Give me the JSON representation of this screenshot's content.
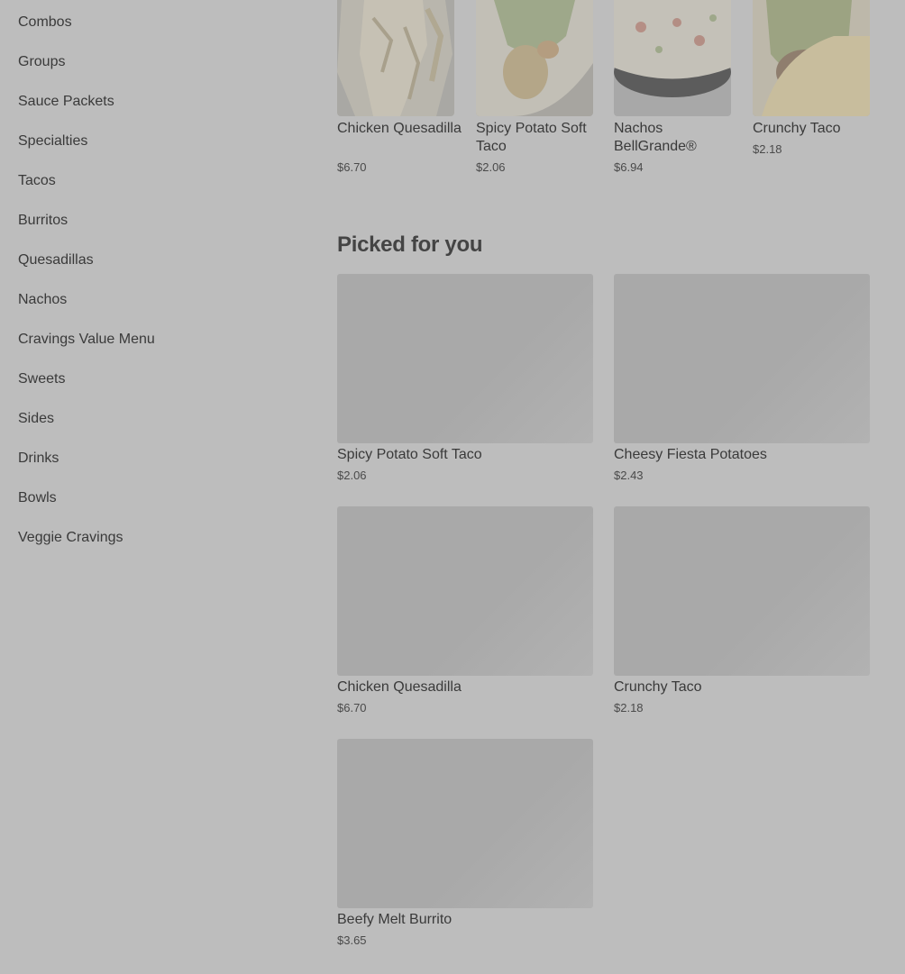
{
  "sidebar": {
    "items": [
      {
        "label": "Combos"
      },
      {
        "label": "Groups"
      },
      {
        "label": "Sauce Packets"
      },
      {
        "label": "Specialties"
      },
      {
        "label": "Tacos"
      },
      {
        "label": "Burritos"
      },
      {
        "label": "Quesadillas"
      },
      {
        "label": "Nachos"
      },
      {
        "label": "Cravings Value Menu"
      },
      {
        "label": "Sweets"
      },
      {
        "label": "Sides"
      },
      {
        "label": "Drinks"
      },
      {
        "label": "Bowls"
      },
      {
        "label": "Veggie Cravings"
      }
    ]
  },
  "top_items": [
    {
      "name": "Chicken Quesadilla",
      "price": "$6.70"
    },
    {
      "name": "Spicy Potato Soft Taco",
      "price": "$2.06"
    },
    {
      "name": "Nachos BellGrande®",
      "price": "$6.94"
    },
    {
      "name": "Crunchy Taco",
      "price": "$2.18"
    }
  ],
  "picked": {
    "title": "Picked for you",
    "items": [
      {
        "name": "Spicy Potato Soft Taco",
        "price": "$2.06"
      },
      {
        "name": "Cheesy Fiesta Potatoes",
        "price": "$2.43"
      },
      {
        "name": "Chicken Quesadilla",
        "price": "$6.70"
      },
      {
        "name": "Crunchy Taco",
        "price": "$2.18"
      },
      {
        "name": "Beefy Melt Burrito",
        "price": "$3.65"
      }
    ]
  }
}
